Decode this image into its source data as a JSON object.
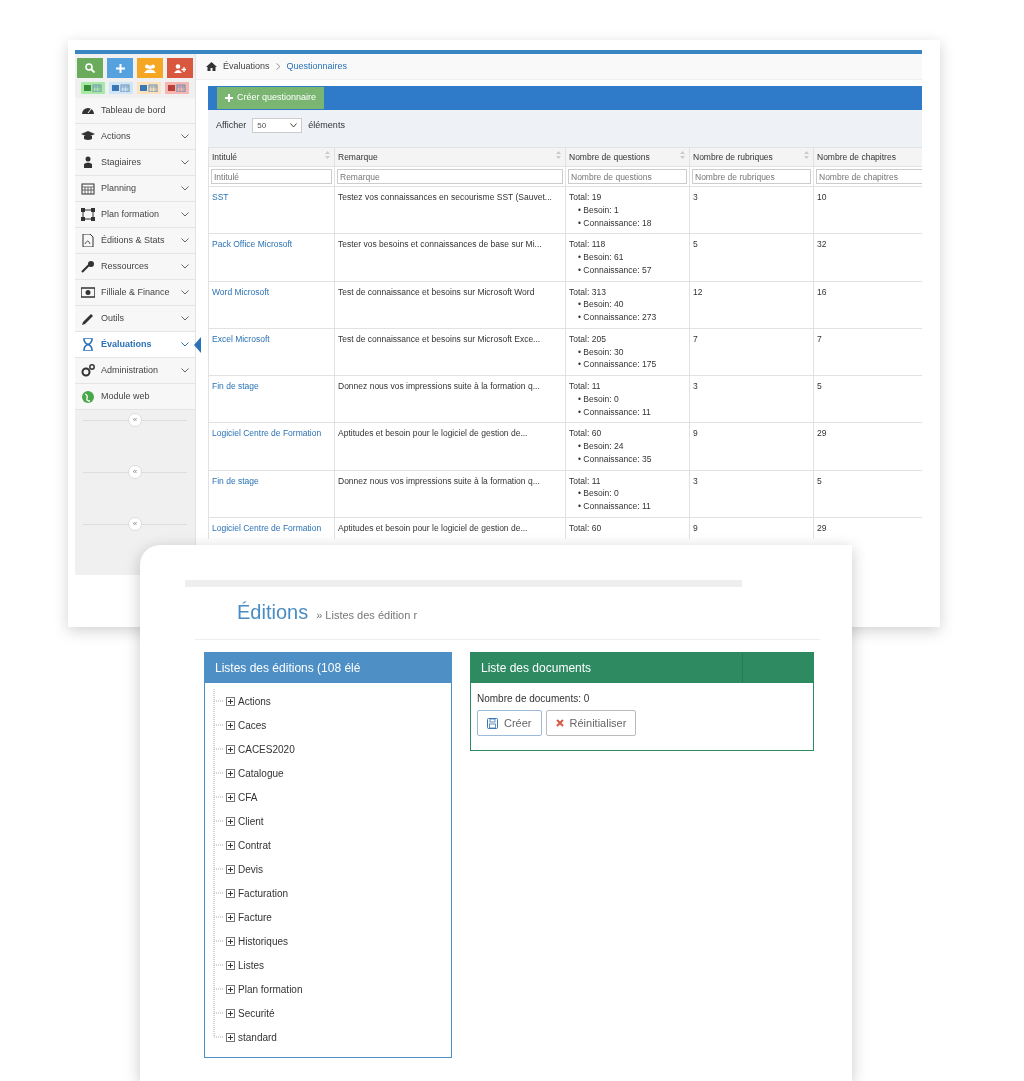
{
  "top_window": {
    "sidebar": {
      "items": [
        {
          "label": "Tableau de bord",
          "has_submenu": false,
          "selected": false
        },
        {
          "label": "Actions",
          "has_submenu": true,
          "selected": false
        },
        {
          "label": "Stagiaires",
          "has_submenu": true,
          "selected": false
        },
        {
          "label": "Planning",
          "has_submenu": true,
          "selected": false
        },
        {
          "label": "Plan formation",
          "has_submenu": true,
          "selected": false
        },
        {
          "label": "Éditions & Stats",
          "has_submenu": true,
          "selected": false
        },
        {
          "label": "Ressources",
          "has_submenu": true,
          "selected": false
        },
        {
          "label": "Filliale & Finance",
          "has_submenu": true,
          "selected": false
        },
        {
          "label": "Outils",
          "has_submenu": true,
          "selected": false
        },
        {
          "label": "Évaluations",
          "has_submenu": true,
          "selected": true
        },
        {
          "label": "Administration",
          "has_submenu": true,
          "selected": false
        },
        {
          "label": "Module web",
          "has_submenu": false,
          "selected": false
        }
      ],
      "collapse_toggles": [
        "«",
        "«",
        "«"
      ]
    },
    "breadcrumb": [
      "Évaluations",
      "Questionnaires"
    ],
    "create_button": "Créer questionnaire",
    "page_length": {
      "label_before": "Afficher",
      "value": "50",
      "label_after": "éléments"
    },
    "table": {
      "columns": [
        {
          "label": "Intitulé",
          "sortable": true,
          "placeholder": "Intitulé"
        },
        {
          "label": "Remarque",
          "sortable": true,
          "placeholder": "Remarque"
        },
        {
          "label": "Nombre de questions",
          "sortable": true,
          "placeholder": "Nombre de questions"
        },
        {
          "label": "Nombre de rubriques",
          "sortable": true,
          "placeholder": "Nombre de rubriques"
        },
        {
          "label": "Nombre de chapitres",
          "sortable": false,
          "placeholder": "Nombre de chapitres"
        }
      ],
      "rows": [
        {
          "title": "SST",
          "remark": "Testez vos connaissances en secourisme SST (Sauvet...",
          "total": "Total: 19",
          "details": [
            "• Besoin: 1",
            "• Connaissance: 18"
          ],
          "rubriques": "3",
          "chapitres": "10"
        },
        {
          "title": "Pack Office Microsoft",
          "remark": "Tester vos besoins et connaissances de base sur Mi...",
          "total": "Total: 118",
          "details": [
            "• Besoin: 61",
            "• Connaissance: 57"
          ],
          "rubriques": "5",
          "chapitres": "32"
        },
        {
          "title": "Word Microsoft",
          "remark": "Test de connaissance et besoins sur Microsoft Word",
          "total": "Total: 313",
          "details": [
            "• Besoin: 40",
            "• Connaissance: 273"
          ],
          "rubriques": "12",
          "chapitres": "16"
        },
        {
          "title": "Excel Microsoft",
          "remark": "Test de connaissance et besoins sur Microsoft Exce...",
          "total": "Total: 205",
          "details": [
            "• Besoin: 30",
            "• Connaissance: 175"
          ],
          "rubriques": "7",
          "chapitres": "7"
        },
        {
          "title": "Fin de stage",
          "remark": "Donnez nous vos impressions suite à la formation q...",
          "total": "Total: 11",
          "details": [
            "• Besoin: 0",
            "• Connaissance: 11"
          ],
          "rubriques": "3",
          "chapitres": "5"
        },
        {
          "title": "Logiciel Centre de Formation",
          "remark": "Aptitudes et besoin pour le logiciel de gestion de...",
          "total": "Total: 60",
          "details": [
            "• Besoin: 24",
            "• Connaissance: 35"
          ],
          "rubriques": "9",
          "chapitres": "29"
        },
        {
          "title": "Fin de stage",
          "remark": "Donnez nous vos impressions suite à la formation q...",
          "total": "Total: 11",
          "details": [
            "• Besoin: 0",
            "• Connaissance: 11"
          ],
          "rubriques": "3",
          "chapitres": "5"
        },
        {
          "title": "Logiciel Centre de Formation",
          "remark": "Aptitudes et besoin pour le logiciel de gestion de...",
          "total": "Total: 60",
          "rubriques": "9",
          "chapitres": "29"
        }
      ]
    }
  },
  "bottom_window": {
    "title": "Éditions",
    "subtitle": "» Listes des édition r",
    "tree_panel": {
      "title": "Listes des éditions (108 élé",
      "items": [
        {
          "label": "Actions",
          "expanded": false
        },
        {
          "label": "Caces",
          "expanded": false
        },
        {
          "label": "CACES2020",
          "expanded": false
        },
        {
          "label": "Catalogue",
          "expanded": false
        },
        {
          "label": "CFA",
          "expanded": false
        },
        {
          "label": "Client",
          "expanded": false
        },
        {
          "label": "Contrat",
          "expanded": false
        },
        {
          "label": "Devis",
          "expanded": false
        },
        {
          "label": "Facturation",
          "expanded": false
        },
        {
          "label": "Facture",
          "expanded": false
        },
        {
          "label": "Historiques",
          "expanded": false
        },
        {
          "label": "Listes",
          "expanded": false
        },
        {
          "label": "Plan formation",
          "expanded": false
        },
        {
          "label": "Securité",
          "expanded": false
        },
        {
          "label": "standard",
          "expanded": false
        }
      ]
    },
    "documents_panel": {
      "title": "Liste des documents",
      "count": "Nombre de documents: 0",
      "buttons": [
        {
          "label": "Créer",
          "kind": "save"
        },
        {
          "label": "Réinitialiser",
          "kind": "reset"
        }
      ]
    }
  }
}
